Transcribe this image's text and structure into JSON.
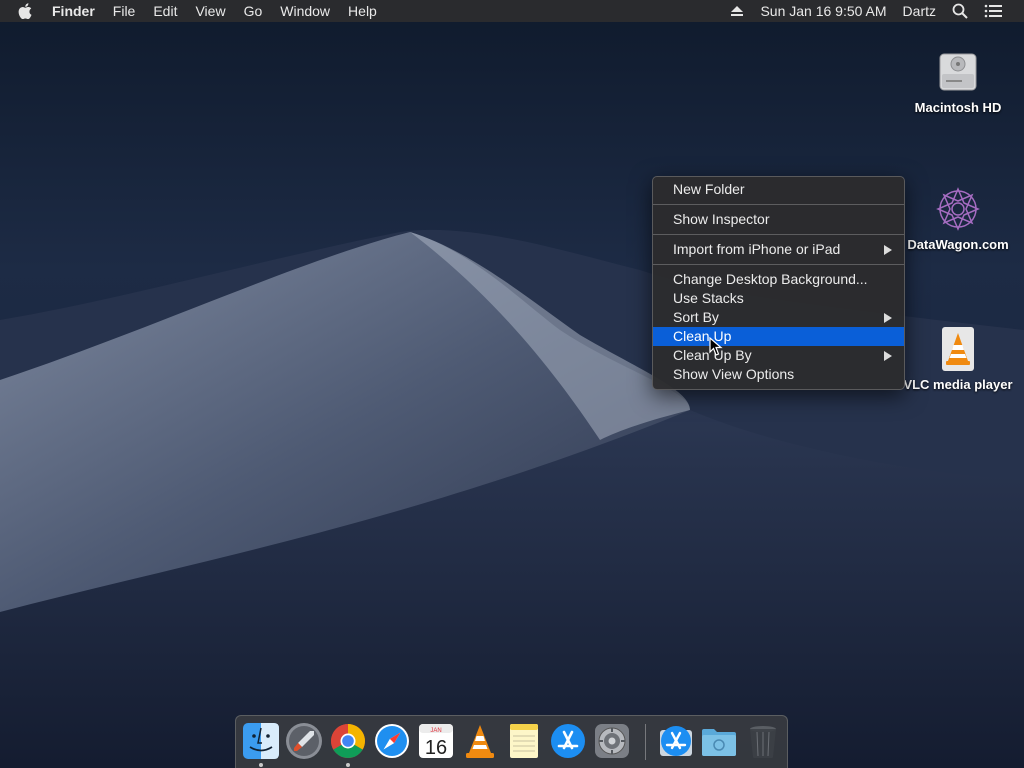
{
  "menubar": {
    "apple_icon": "apple-logo-icon",
    "app_name": "Finder",
    "items": [
      "File",
      "Edit",
      "View",
      "Go",
      "Window",
      "Help"
    ],
    "datetime": "Sun Jan 16  9:50 AM",
    "user": "Dartz",
    "status_icons": [
      "eject-icon",
      "search-icon",
      "list-icon"
    ]
  },
  "desktop_icons": [
    {
      "label": "Macintosh HD",
      "icon": "hard-drive-icon"
    },
    {
      "label": "DataWagon.com",
      "icon": "datawagon-logo-icon"
    },
    {
      "label": "VLC media player",
      "icon": "vlc-cone-icon"
    }
  ],
  "context_menu": {
    "items": [
      {
        "label": "New Folder"
      },
      {
        "label": "Show Inspector"
      },
      {
        "label": "Import from iPhone or iPad",
        "submenu": true
      },
      {
        "label": "Change Desktop Background..."
      },
      {
        "label": "Use Stacks"
      },
      {
        "label": "Sort By",
        "submenu": true
      },
      {
        "label": "Clean Up",
        "selected": true
      },
      {
        "label": "Clean Up By",
        "submenu": true
      },
      {
        "label": "Show View Options"
      }
    ],
    "selected_color": "#0a5fd8"
  },
  "dock": {
    "apps": [
      {
        "name": "Finder",
        "icon": "finder-icon",
        "running": true
      },
      {
        "name": "Launchpad",
        "icon": "launchpad-icon",
        "running": false
      },
      {
        "name": "Google Chrome",
        "icon": "chrome-icon",
        "running": true
      },
      {
        "name": "Safari",
        "icon": "safari-icon",
        "running": false
      },
      {
        "name": "Calendar",
        "icon": "calendar-icon",
        "running": false,
        "month": "JAN",
        "day": "16"
      },
      {
        "name": "VLC",
        "icon": "vlc-icon",
        "running": false
      },
      {
        "name": "Notes",
        "icon": "notes-icon",
        "running": false
      },
      {
        "name": "App Store",
        "icon": "app-store-icon",
        "running": false
      },
      {
        "name": "System Preferences",
        "icon": "system-preferences-icon",
        "running": false
      },
      {
        "name": "Downloads",
        "icon": "downloads-stack-icon",
        "running": false
      },
      {
        "name": "Folder",
        "icon": "folder-stack-icon",
        "running": false
      },
      {
        "name": "Trash",
        "icon": "trash-icon",
        "running": false
      }
    ]
  }
}
